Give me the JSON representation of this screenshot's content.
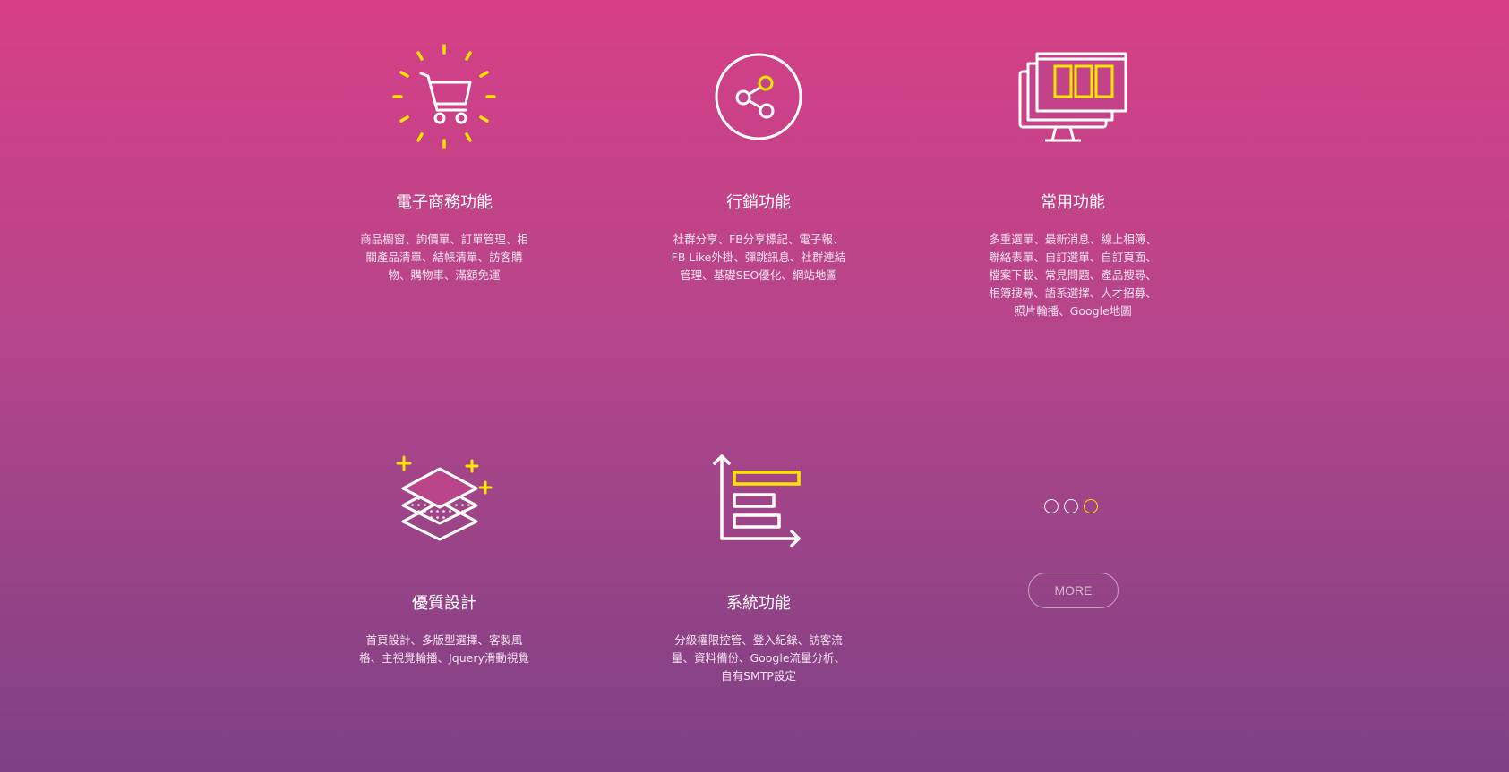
{
  "colors": {
    "gradient_top": "#d63f86",
    "gradient_bottom": "#7d4185",
    "icon_stroke": "#ffffff",
    "accent": "#ffe600"
  },
  "features": [
    {
      "icon": "shopping-cart-icon",
      "title": "電子商務功能",
      "desc": [
        "商品櫥窗、詢價單、訂單管理、相",
        "關產品清單、結帳清單、訪客購",
        "物、購物車、滿額免運"
      ]
    },
    {
      "icon": "share-icon",
      "title": "行銷功能",
      "desc": [
        "社群分享、FB分享標記、電子報、",
        "FB Like外掛、彈跳訊息、社群連結",
        "管理、基礎SEO優化、網站地圖"
      ]
    },
    {
      "icon": "monitor-windows-icon",
      "title": "常用功能",
      "desc": [
        "多重選單、最新消息、線上相簿、",
        "聯絡表單、自訂選單、自訂頁面、",
        "檔案下載、常見問題、產品搜尋、",
        "相簿搜尋、語系選擇、人才招募、",
        "照片輪播、Google地圖"
      ]
    },
    {
      "icon": "layers-icon",
      "title": "優質設計",
      "desc": [
        "首頁設計、多版型選擇、客製風",
        "格、主視覺輪播、Jquery滑動視覺"
      ]
    },
    {
      "icon": "bar-chart-icon",
      "title": "系統功能",
      "desc": [
        "分級權限控管、登入紀錄、訪客流",
        "量、資料備份、Google流量分析、",
        "自有SMTP設定"
      ]
    }
  ],
  "carousel": {
    "dot_count": 3,
    "active_index": 2
  },
  "more_button": {
    "label": "MORE"
  }
}
